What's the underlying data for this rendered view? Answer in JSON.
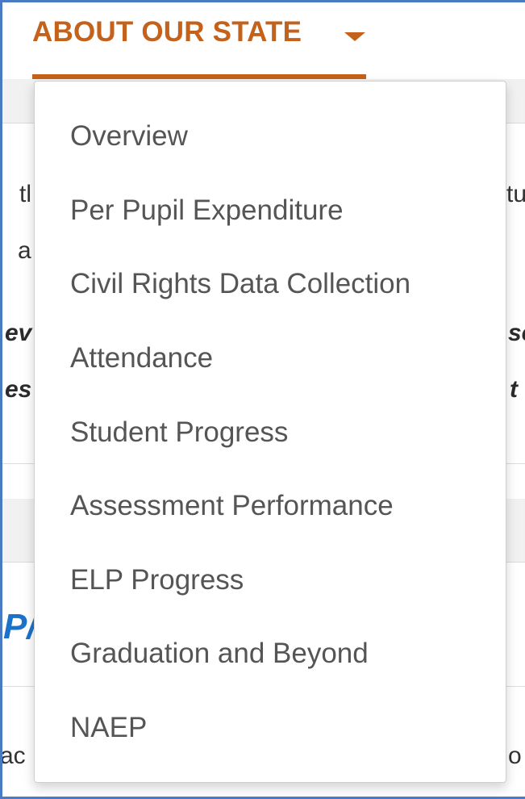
{
  "nav": {
    "active_tab_label": "ABOUT OUR STATE",
    "accent_color": "#c4611a",
    "caret_icon": "caret-down-icon"
  },
  "background": {
    "fragments": [
      "tl",
      "tu",
      "a",
      "ev",
      "se",
      "es",
      "t",
      "P/",
      "ac",
      "o"
    ]
  },
  "dropdown": {
    "items": [
      {
        "label": "Overview"
      },
      {
        "label": "Per Pupil Expenditure"
      },
      {
        "label": "Civil Rights Data Collection"
      },
      {
        "label": "Attendance"
      },
      {
        "label": "Student Progress"
      },
      {
        "label": "Assessment Performance"
      },
      {
        "label": "ELP Progress"
      },
      {
        "label": "Graduation and Beyond"
      },
      {
        "label": "NAEP"
      }
    ]
  }
}
